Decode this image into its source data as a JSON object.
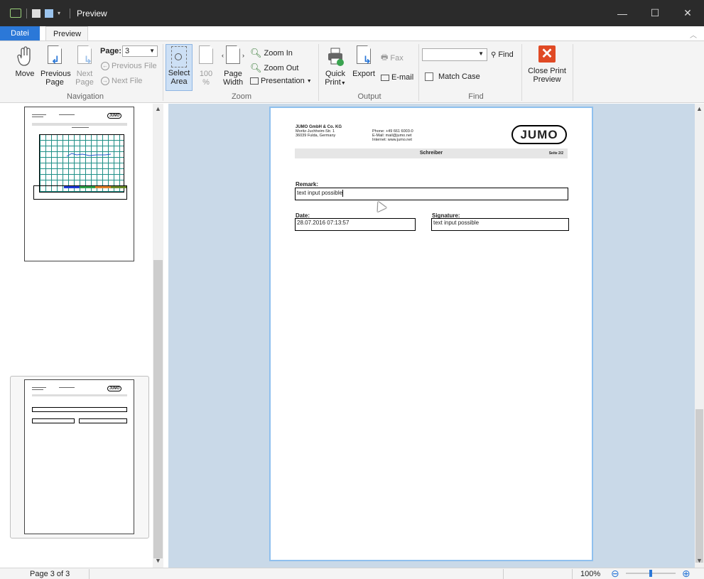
{
  "window": {
    "title": "Preview",
    "minimize": "—",
    "maximize": "☐",
    "close": "✕"
  },
  "tabs": {
    "file": "Datei",
    "preview": "Preview"
  },
  "ribbon": {
    "navigation": {
      "label": "Navigation",
      "move": "Move",
      "previous_page_1": "Previous",
      "previous_page_2": "Page",
      "next_page_1": "Next",
      "next_page_2": "Page",
      "page_label": "Page:",
      "page_value": "3",
      "previous_file": "Previous File",
      "next_file": "Next File"
    },
    "zoom": {
      "label": "Zoom",
      "select_area_1": "Select",
      "select_area_2": "Area",
      "hundred_1": "100",
      "hundred_2": "%",
      "page_width_1": "Page",
      "page_width_2": "Width",
      "zoom_in": "Zoom In",
      "zoom_out": "Zoom Out",
      "presentation": "Presentation"
    },
    "output": {
      "label": "Output",
      "quick_print_1": "Quick",
      "quick_print_2": "Print",
      "export": "Export",
      "fax": "Fax",
      "email": "E-mail"
    },
    "find": {
      "label": "Find",
      "find_button": "Find",
      "match_case": "Match Case",
      "find_value": ""
    },
    "close": {
      "label_1": "Close Print",
      "label_2": "Preview"
    }
  },
  "document": {
    "company": "JUMO GmbH & Co. KG",
    "street": "Moritz-Juchheim-Str. 1",
    "city": "36039 Fulda, Germany",
    "phone_label": "Phone:",
    "phone": "+49 661 6003-0",
    "email_label": "E-Mail:",
    "email": "mail@jumo.net",
    "internet_label": "Internet:",
    "internet": "www.jumo.net",
    "logo": "JUMO",
    "band_title": "Schreiber",
    "band_page": "Seite 2/2",
    "remark_label": "Remark:",
    "remark_value": "text input possible",
    "date_label": "Date:",
    "date_value": "28.07.2016 07:13:57",
    "signature_label": "Signature:",
    "signature_value": "text input possible"
  },
  "status": {
    "page_info": "Page 3 of 3",
    "zoom": "100%",
    "zoom_level": 0.5
  },
  "colors": {
    "accent": "#2b78d8",
    "titlebar": "#2b2b2b",
    "canvas": "#c9d9e8",
    "close_icon": "#e04a25"
  }
}
